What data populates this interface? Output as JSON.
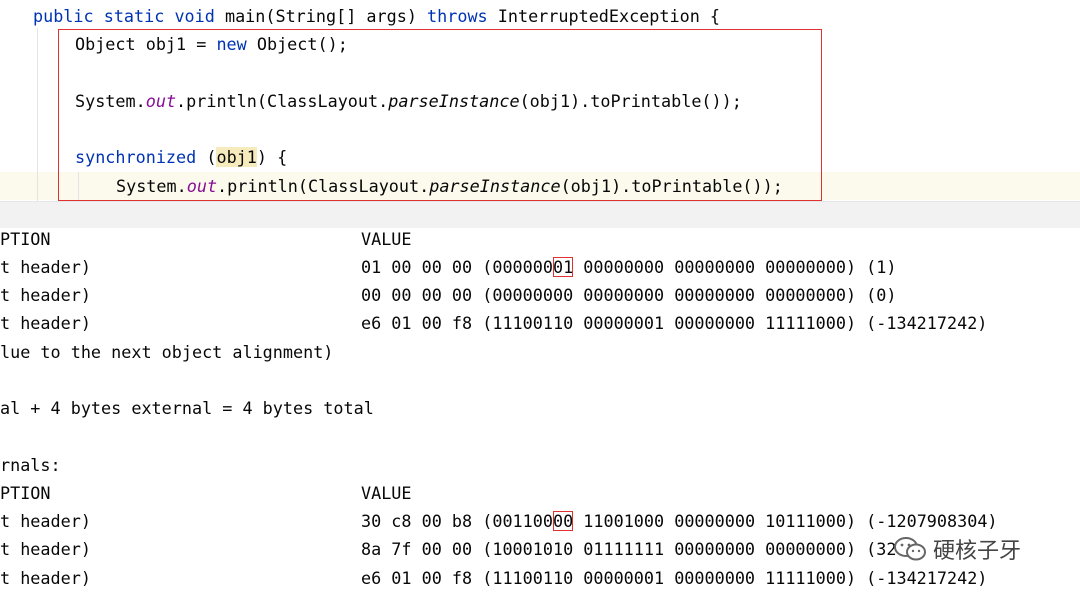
{
  "editor": {
    "line_main_kw": "public static void",
    "line_main_sig": " main(String[] args) ",
    "line_main_throws": "throws",
    "line_main_exc": " InterruptedException {",
    "line1_a": "Object obj1 = ",
    "line1_new": "new",
    "line1_b": " Object();",
    "line2_a": "System.",
    "line2_out": "out",
    "line2_b": ".println(ClassLayout.",
    "line2_parse": "parseInstance",
    "line2_c": "(obj1).toPrintable());",
    "line3_sync": "synchronized",
    "line3_a": " (",
    "line3_obj": "obj1",
    "line3_b": ") {",
    "line4_a": "System.",
    "line4_out": "out",
    "line4_b": ".println(ClassLayout.",
    "line4_parse": "parseInstance",
    "line4_c": "(obj1).toPrintable());"
  },
  "console": {
    "block1": {
      "header_desc": "PTION",
      "header_value": "VALUE",
      "rows": [
        {
          "desc": "t header)",
          "value_pre": "01 00 00 00 (000000",
          "value_mark": "01",
          "value_post": " 00000000 00000000 00000000) (1)"
        },
        {
          "desc": "t header)",
          "value": "00 00 00 00 (00000000 00000000 00000000 00000000) (0)"
        },
        {
          "desc": "t header)",
          "value": "e6 01 00 f8 (11100110 00000001 00000000 11111000) (-134217242)"
        }
      ],
      "alignment_line": "lue to the next object alignment)",
      "total_line": "al + 4 bytes external = 4 bytes total"
    },
    "block2": {
      "internals_line": "rnals:",
      "header_desc": "PTION",
      "header_value": "VALUE",
      "rows": [
        {
          "desc": "t header)",
          "value_pre": "30 c8 00 b8 (001100",
          "value_mark": "00",
          "value_post": " 11001000 00000000 10111000) (-1207908304)"
        },
        {
          "desc": "t header)",
          "value": "8a 7f 00 00 (10001010 01111111 00000000 00000000) (32"
        },
        {
          "desc": "t header)",
          "value": "e6 01 00 f8 (11100110 00000001 00000000 11111000) (-134217242)"
        }
      ]
    }
  },
  "watermark": {
    "icon": "wechat-icon",
    "text": "硬核子牙"
  },
  "colors": {
    "keyword": "#0033b3",
    "field": "#871094",
    "highlight_box": "#e0302f",
    "current_line": "#fcfaed",
    "object_highlight": "#f6ebbc"
  }
}
